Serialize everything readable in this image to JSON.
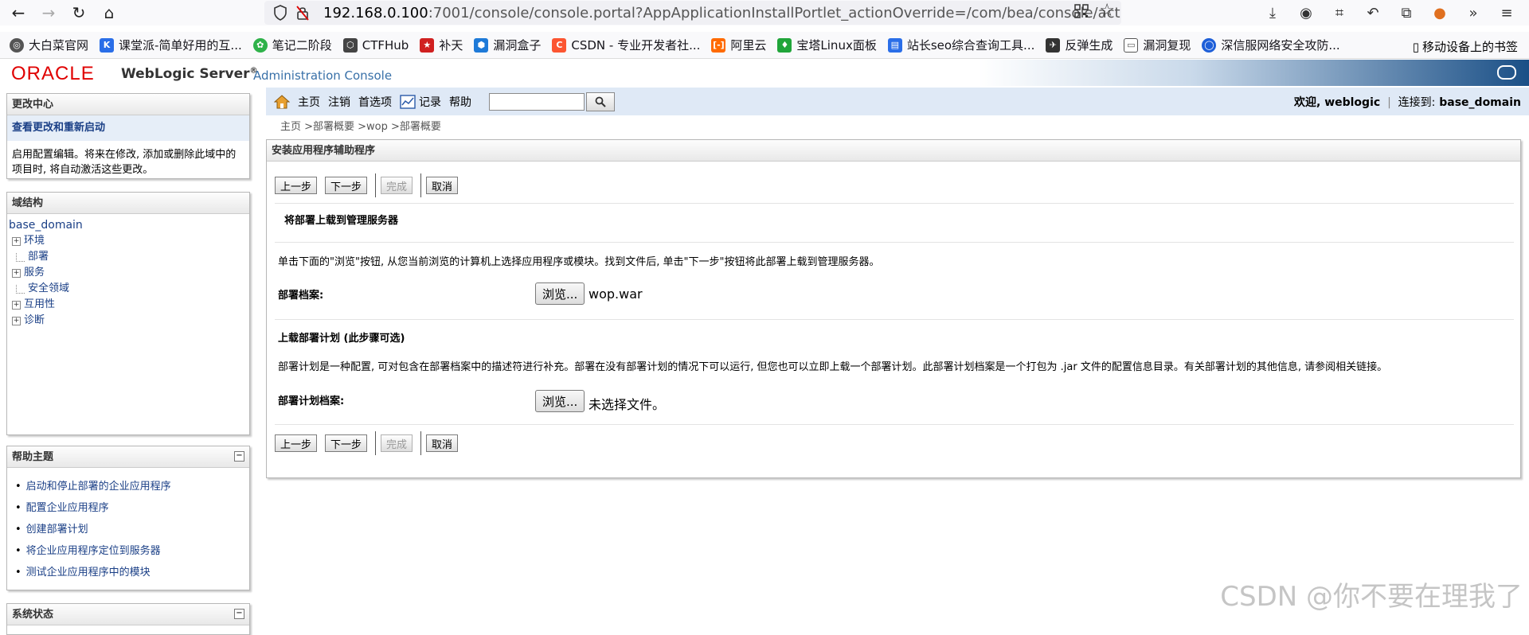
{
  "browser": {
    "url_host": "192.168.0.100",
    "url_rest": ":7001/console/console.portal?AppApplicationInstallPortlet_actionOverride=/com/bea/console/act",
    "bookmarks": [
      {
        "label": "大白菜官网",
        "icon": "globe-icon",
        "color": "#555555"
      },
      {
        "label": "课堂派-简单好用的互...",
        "icon": "ketangpai-icon",
        "color": "#2a6ee8"
      },
      {
        "label": "笔记二阶段",
        "icon": "leaf-icon",
        "color": "#2fb24a"
      },
      {
        "label": "CTFHub",
        "icon": "cube-icon",
        "color": "#444444"
      },
      {
        "label": "补天",
        "icon": "star-icon",
        "color": "#d02020"
      },
      {
        "label": "漏洞盒子",
        "icon": "hex-icon",
        "color": "#1e7ad8"
      },
      {
        "label": "CSDN - 专业开发者社...",
        "icon": "csdn-icon",
        "color": "#fc5531"
      },
      {
        "label": "阿里云",
        "icon": "aliyun-icon",
        "color": "#ff6a00"
      },
      {
        "label": "宝塔Linux面板",
        "icon": "shield-icon",
        "color": "#20a53a"
      },
      {
        "label": "站长seo综合查询工具...",
        "icon": "chart-icon",
        "color": "#2a6ee8"
      },
      {
        "label": "反弹生成",
        "icon": "plane-icon",
        "color": "#333333"
      },
      {
        "label": "漏洞复现",
        "icon": "folder-icon",
        "color": "#555555"
      },
      {
        "label": "深信服网络安全攻防...",
        "icon": "ring-icon",
        "color": "#1e5fd8"
      }
    ],
    "mobile_bookmarks": "移动设备上的书签"
  },
  "header": {
    "logo": "ORACLE",
    "product": "WebLogic Server",
    "reg": "®",
    "subtitle": "Administration Console"
  },
  "change_center": {
    "title": "更改中心",
    "link": "查看更改和重新启动",
    "text": "启用配置编辑。将来在修改, 添加或删除此域中的项目时, 将自动激活这些更改。"
  },
  "domain_structure": {
    "title": "域结构",
    "root": "base_domain",
    "nodes": [
      {
        "label": "环境",
        "expandable": true
      },
      {
        "label": "部署",
        "expandable": false
      },
      {
        "label": "服务",
        "expandable": true
      },
      {
        "label": "安全领域",
        "expandable": false
      },
      {
        "label": "互用性",
        "expandable": true
      },
      {
        "label": "诊断",
        "expandable": true
      }
    ]
  },
  "help_topics": {
    "title": "帮助主题",
    "items": [
      "启动和停止部署的企业应用程序",
      "配置企业应用程序",
      "创建部署计划",
      "将企业应用程序定位到服务器",
      "测试企业应用程序中的模块"
    ]
  },
  "system_status": {
    "title": "系统状态"
  },
  "topnav": {
    "home": "主页",
    "logout": "注销",
    "preferences": "首选项",
    "record": "记录",
    "help": "帮助",
    "welcome_label": "欢迎,",
    "user": "weblogic",
    "connected_label": "连接到:",
    "domain": "base_domain"
  },
  "breadcrumb": "主页 >部署概要 >wop >部署概要",
  "wizard": {
    "title": "安装应用程序辅助程序",
    "buttons": {
      "back": "上一步",
      "next": "下一步",
      "finish": "完成",
      "cancel": "取消"
    },
    "upload_title": "将部署上载到管理服务器",
    "upload_desc": "单击下面的\"浏览\"按钮, 从您当前浏览的计算机上选择应用程序或模块。找到文件后, 单击\"下一步\"按钮将此部署上载到管理服务器。",
    "archive_label": "部署档案:",
    "browse_label": "浏览...",
    "archive_file": "wop.war",
    "plan_title": "上载部署计划 (此步骤可选)",
    "plan_desc": "部署计划是一种配置, 可对包含在部署档案中的描述符进行补充。部署在没有部署计划的情况下可以运行, 但您也可以立即上载一个部署计划。此部署计划档案是一个打包为 .jar 文件的配置信息目录。有关部署计划的其他信息, 请参阅相关链接。",
    "plan_label": "部署计划档案:",
    "plan_file": "未选择文件。"
  },
  "watermark": "CSDN @你不要在理我了"
}
